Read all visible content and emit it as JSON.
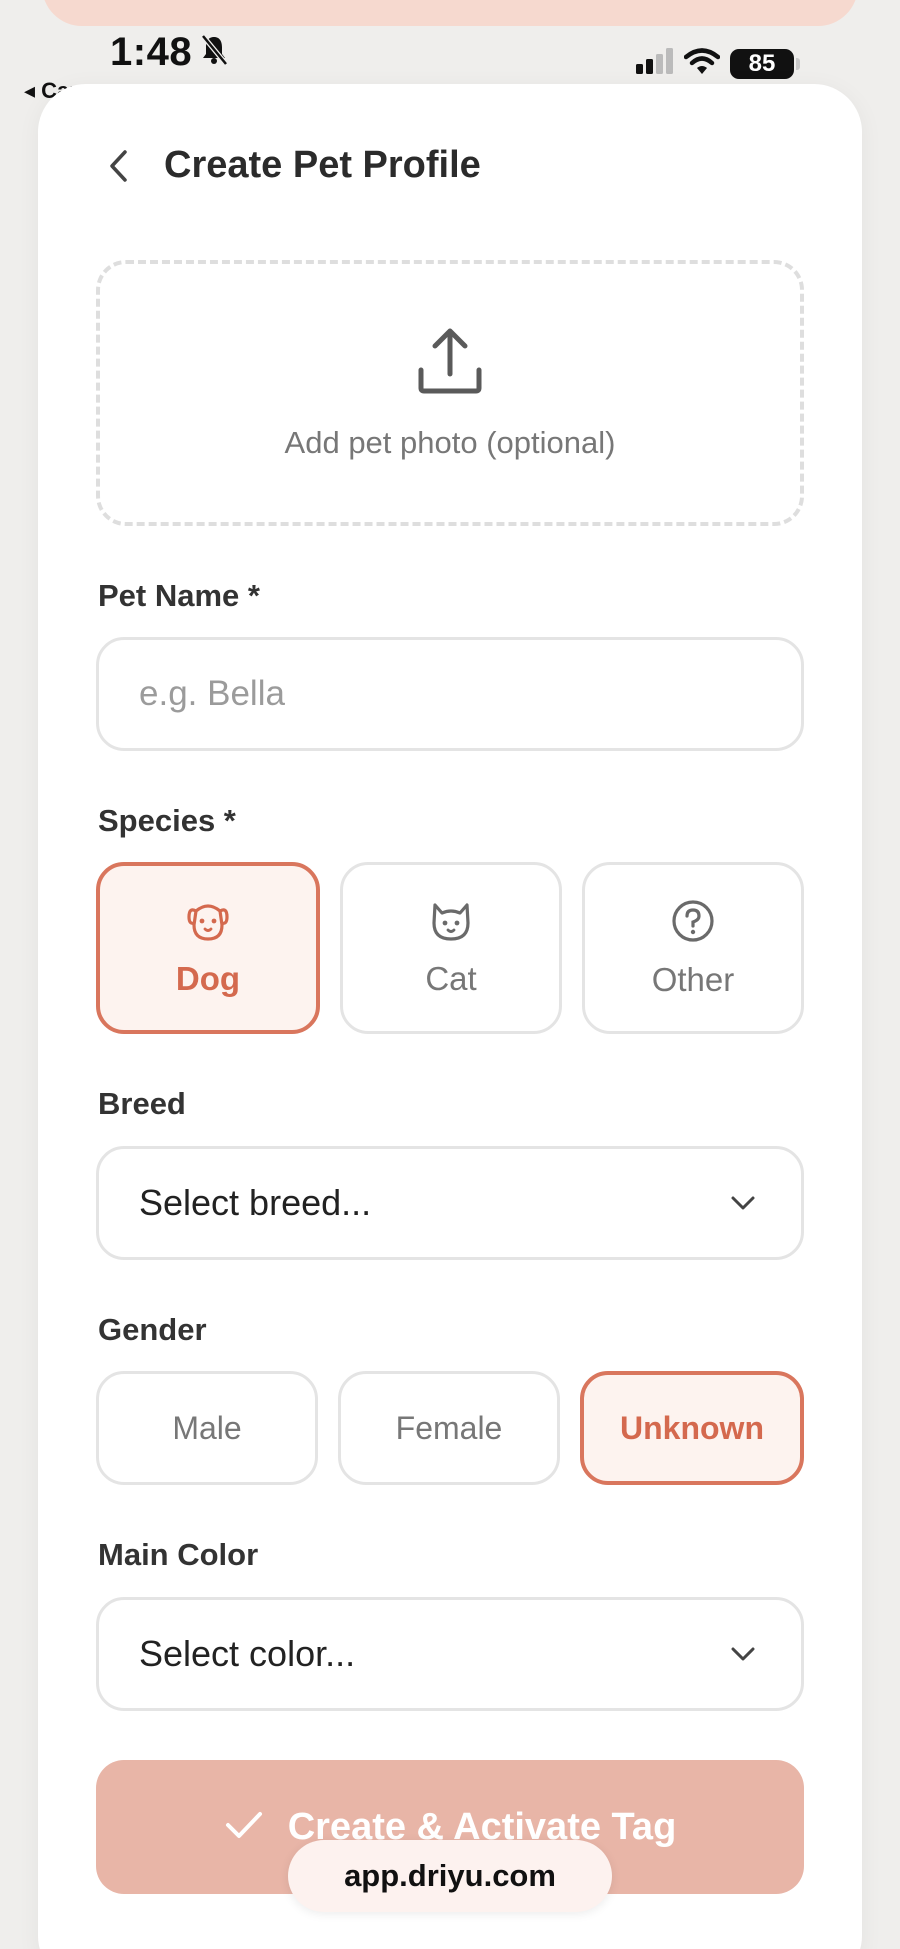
{
  "status_bar": {
    "time": "1:48",
    "back_app": "◂ Camera",
    "battery": "85"
  },
  "header": {
    "title": "Create Pet Profile"
  },
  "photo_upload": {
    "label": "Add pet photo (optional)",
    "icon": "upload-icon"
  },
  "pet_name": {
    "label": "Pet Name *",
    "placeholder": "e.g. Bella",
    "value": ""
  },
  "species": {
    "label": "Species *",
    "options": [
      {
        "label": "Dog",
        "icon": "dog-icon",
        "selected": true
      },
      {
        "label": "Cat",
        "icon": "cat-icon",
        "selected": false
      },
      {
        "label": "Other",
        "icon": "question-circle-icon",
        "selected": false
      }
    ]
  },
  "breed": {
    "label": "Breed",
    "selected": "Select breed..."
  },
  "gender": {
    "label": "Gender",
    "options": [
      {
        "label": "Male",
        "selected": false
      },
      {
        "label": "Female",
        "selected": false
      },
      {
        "label": "Unknown",
        "selected": true
      }
    ]
  },
  "main_color": {
    "label": "Main Color",
    "selected": "Select color..."
  },
  "submit": {
    "label": "Create & Activate Tag"
  },
  "browser": {
    "url": "app.driyu.com"
  },
  "colors": {
    "accent": "#d9765d",
    "accent_bg": "#fdf3ef",
    "button_disabled": "#e8b5a7"
  }
}
